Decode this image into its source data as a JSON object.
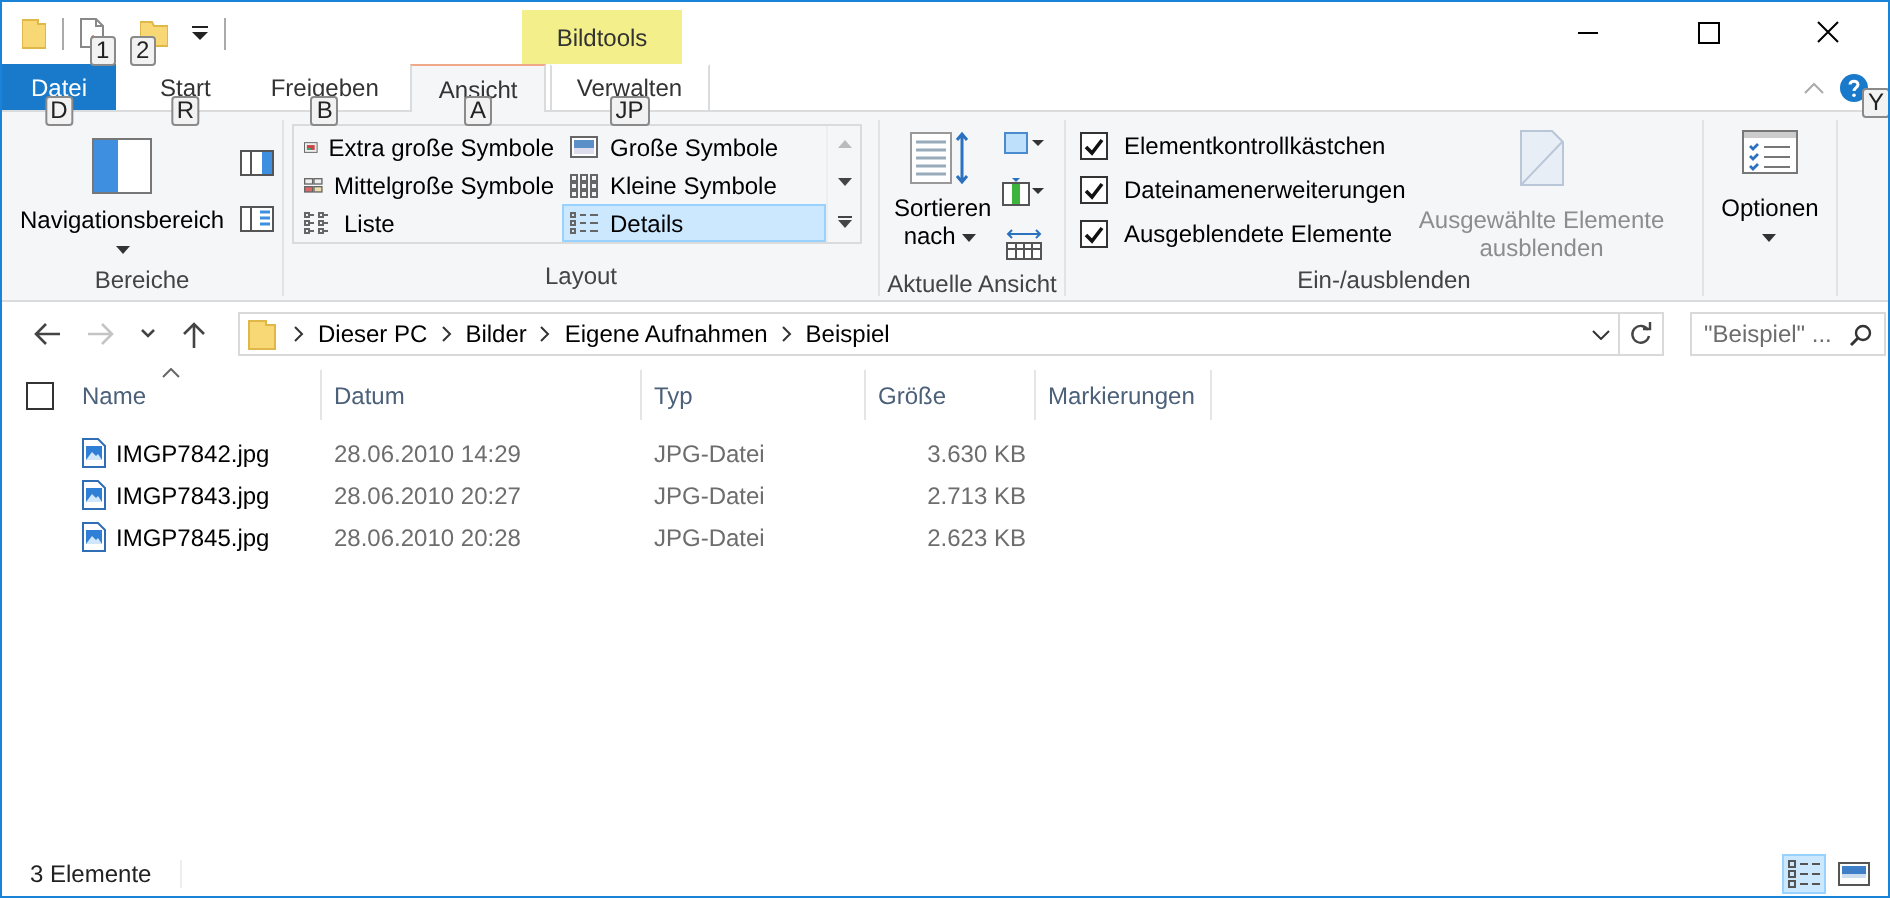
{
  "quick_access_toolbar": {
    "keytips": [
      "1",
      "2"
    ]
  },
  "context_tab_group": {
    "label": "Bildtools"
  },
  "tabs": [
    {
      "label": "Datei",
      "kind": "file",
      "selected": false,
      "keytip": "D"
    },
    {
      "label": "Start",
      "kind": "tab",
      "selected": false,
      "keytip": "R"
    },
    {
      "label": "Freigeben",
      "kind": "tab",
      "selected": false,
      "keytip": "B"
    },
    {
      "label": "Ansicht",
      "kind": "tab",
      "selected": true,
      "keytip": "A"
    },
    {
      "label": "Verwalten",
      "kind": "context",
      "selected": false,
      "keytip": "JP"
    }
  ],
  "help_keytip": "Y",
  "ribbon": {
    "panes": {
      "title": "Bereiche",
      "navigation_pane": "Navigationsbereich"
    },
    "layout": {
      "title": "Layout",
      "options": [
        {
          "label": "Extra große Symbole",
          "kind": "extra_large",
          "selected": false
        },
        {
          "label": "Große Symbole",
          "kind": "large",
          "selected": false
        },
        {
          "label": "Mittelgroße Symbole",
          "kind": "medium",
          "selected": false
        },
        {
          "label": "Kleine Symbole",
          "kind": "small",
          "selected": false
        },
        {
          "label": "Liste",
          "kind": "list",
          "selected": false
        },
        {
          "label": "Details",
          "kind": "details",
          "selected": true
        }
      ]
    },
    "current_view": {
      "title": "Aktuelle Ansicht",
      "sort_by": "Sortieren nach"
    },
    "show_hide": {
      "title": "Ein-/ausblenden",
      "checkboxes": [
        {
          "label": "Elementkontrollkästchen",
          "checked": true
        },
        {
          "label": "Dateinamenerweiterungen",
          "checked": true
        },
        {
          "label": "Ausgeblendete Elemente",
          "checked": true
        }
      ],
      "hide_selected": {
        "label": "Ausgewählte Elemente ausblenden",
        "disabled": true
      }
    },
    "options": {
      "label": "Optionen"
    }
  },
  "navigation": [
    {
      "kind": "back",
      "disabled": false
    },
    {
      "kind": "forward",
      "disabled": true
    },
    {
      "kind": "recent",
      "disabled": false
    },
    {
      "kind": "up",
      "disabled": false
    }
  ],
  "address_bar": {
    "path": [
      "Dieser PC",
      "Bilder",
      "Eigene Aufnahmen",
      "Beispiel"
    ]
  },
  "search": {
    "placeholder": "\"Beispiel\" ..."
  },
  "file_list": {
    "select_all": {
      "checked": false
    },
    "columns": [
      {
        "label": "Name",
        "sorted": true
      },
      {
        "label": "Datum",
        "sorted": false
      },
      {
        "label": "Typ",
        "sorted": false
      },
      {
        "label": "Größe",
        "sorted": false
      },
      {
        "label": "Markierungen",
        "sorted": false
      }
    ],
    "rows": [
      {
        "name": "IMGP7842.jpg",
        "date": "28.06.2010 14:29",
        "type": "JPG-Datei",
        "size": "3.630 KB"
      },
      {
        "name": "IMGP7843.jpg",
        "date": "28.06.2010 20:27",
        "type": "JPG-Datei",
        "size": "2.713 KB"
      },
      {
        "name": "IMGP7845.jpg",
        "date": "28.06.2010 20:28",
        "type": "JPG-Datei",
        "size": "2.623 KB"
      }
    ]
  },
  "status_bar": {
    "item_count": "3 Elemente",
    "views": [
      {
        "kind": "details",
        "selected": true
      },
      {
        "kind": "large_icons",
        "selected": false
      }
    ]
  }
}
